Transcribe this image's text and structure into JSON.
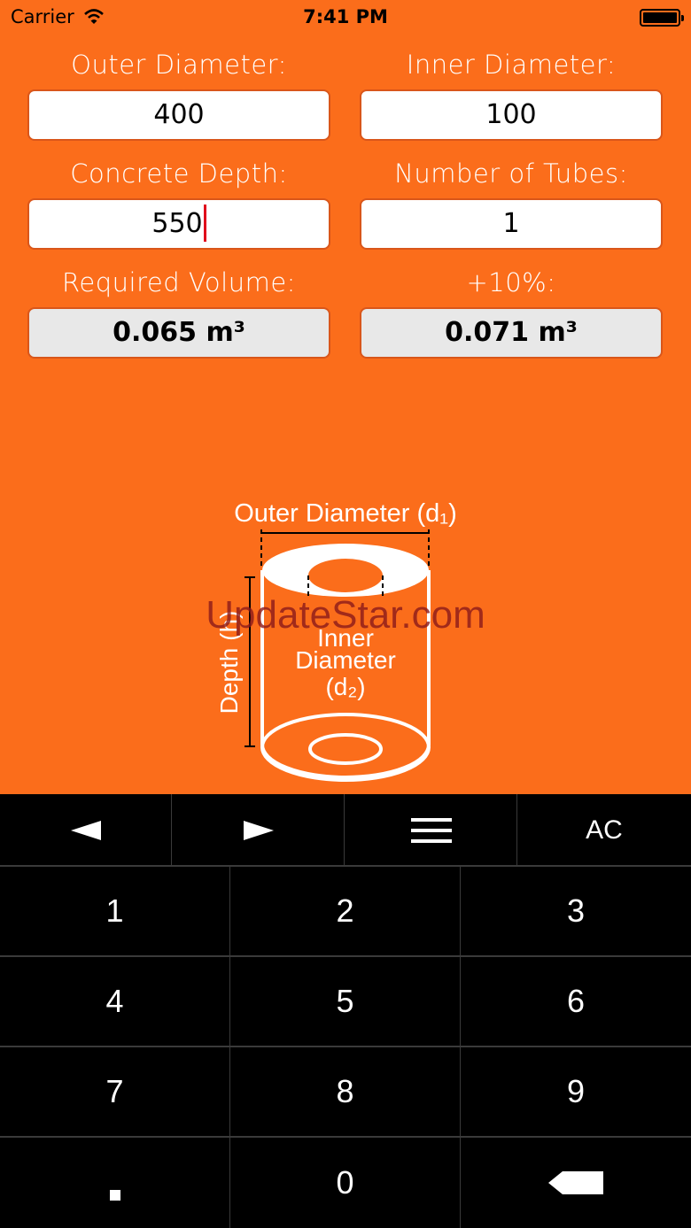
{
  "status": {
    "carrier": "Carrier",
    "time": "7:41 PM"
  },
  "form": {
    "outer_diameter": {
      "label": "Outer Diameter:",
      "value": "400"
    },
    "inner_diameter": {
      "label": "Inner Diameter:",
      "value": "100"
    },
    "concrete_depth": {
      "label": "Concrete Depth:",
      "value": "550"
    },
    "number_of_tubes": {
      "label": "Number of Tubes:",
      "value": "1"
    },
    "required_volume": {
      "label": "Required Volume:",
      "value": "0.065 m³"
    },
    "plus_ten": {
      "label": "+10%:",
      "value": "0.071 m³"
    }
  },
  "diagram": {
    "outer_label": "Outer Diameter (d₁)",
    "depth_label": "Depth (h)",
    "inner_label_1": "Inner",
    "inner_label_2": "Diameter",
    "inner_label_3": "(d₂)"
  },
  "watermark": "UpdateStar.com",
  "toolbar": {
    "prev_icon": "left-arrow-icon",
    "next_icon": "right-arrow-icon",
    "menu_icon": "menu-icon",
    "clear_label": "AC"
  },
  "keypad": {
    "k1": "1",
    "k2": "2",
    "k3": "3",
    "k4": "4",
    "k5": "5",
    "k6": "6",
    "k7": "7",
    "k8": "8",
    "k9": "9",
    "k0": "0",
    "decimal_icon": "decimal-point-icon",
    "backspace_icon": "backspace-icon"
  },
  "colors": {
    "background": "#fb6d1b",
    "keypad": "#000000",
    "caret": "#e0001b"
  }
}
